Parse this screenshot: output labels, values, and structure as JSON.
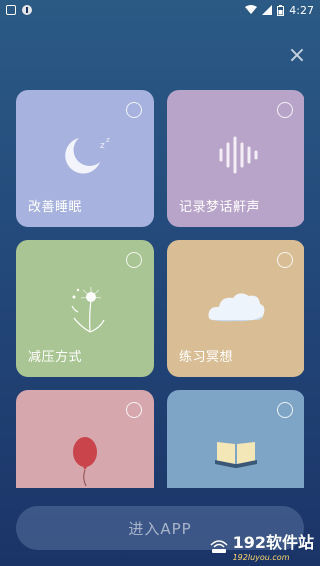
{
  "status": {
    "time": "4:27"
  },
  "close_label": "×",
  "cards": [
    {
      "label": "改善睡眠",
      "icon": "moon-icon",
      "color": "#a7b2df"
    },
    {
      "label": "记录梦话鼾声",
      "icon": "sound-wave-icon",
      "color": "#b8a4c8"
    },
    {
      "label": "减压方式",
      "icon": "dandelion-icon",
      "color": "#a9c593"
    },
    {
      "label": "练习冥想",
      "icon": "cloud-icon",
      "color": "#d9be95"
    },
    {
      "label": "",
      "icon": "balloon-icon",
      "color": "#d7a7ae"
    },
    {
      "label": "",
      "icon": "book-icon",
      "color": "#7ea5c6"
    }
  ],
  "enter_button": "进入APP",
  "watermark": {
    "title": "192软件站",
    "sub": "192luyou.com"
  }
}
